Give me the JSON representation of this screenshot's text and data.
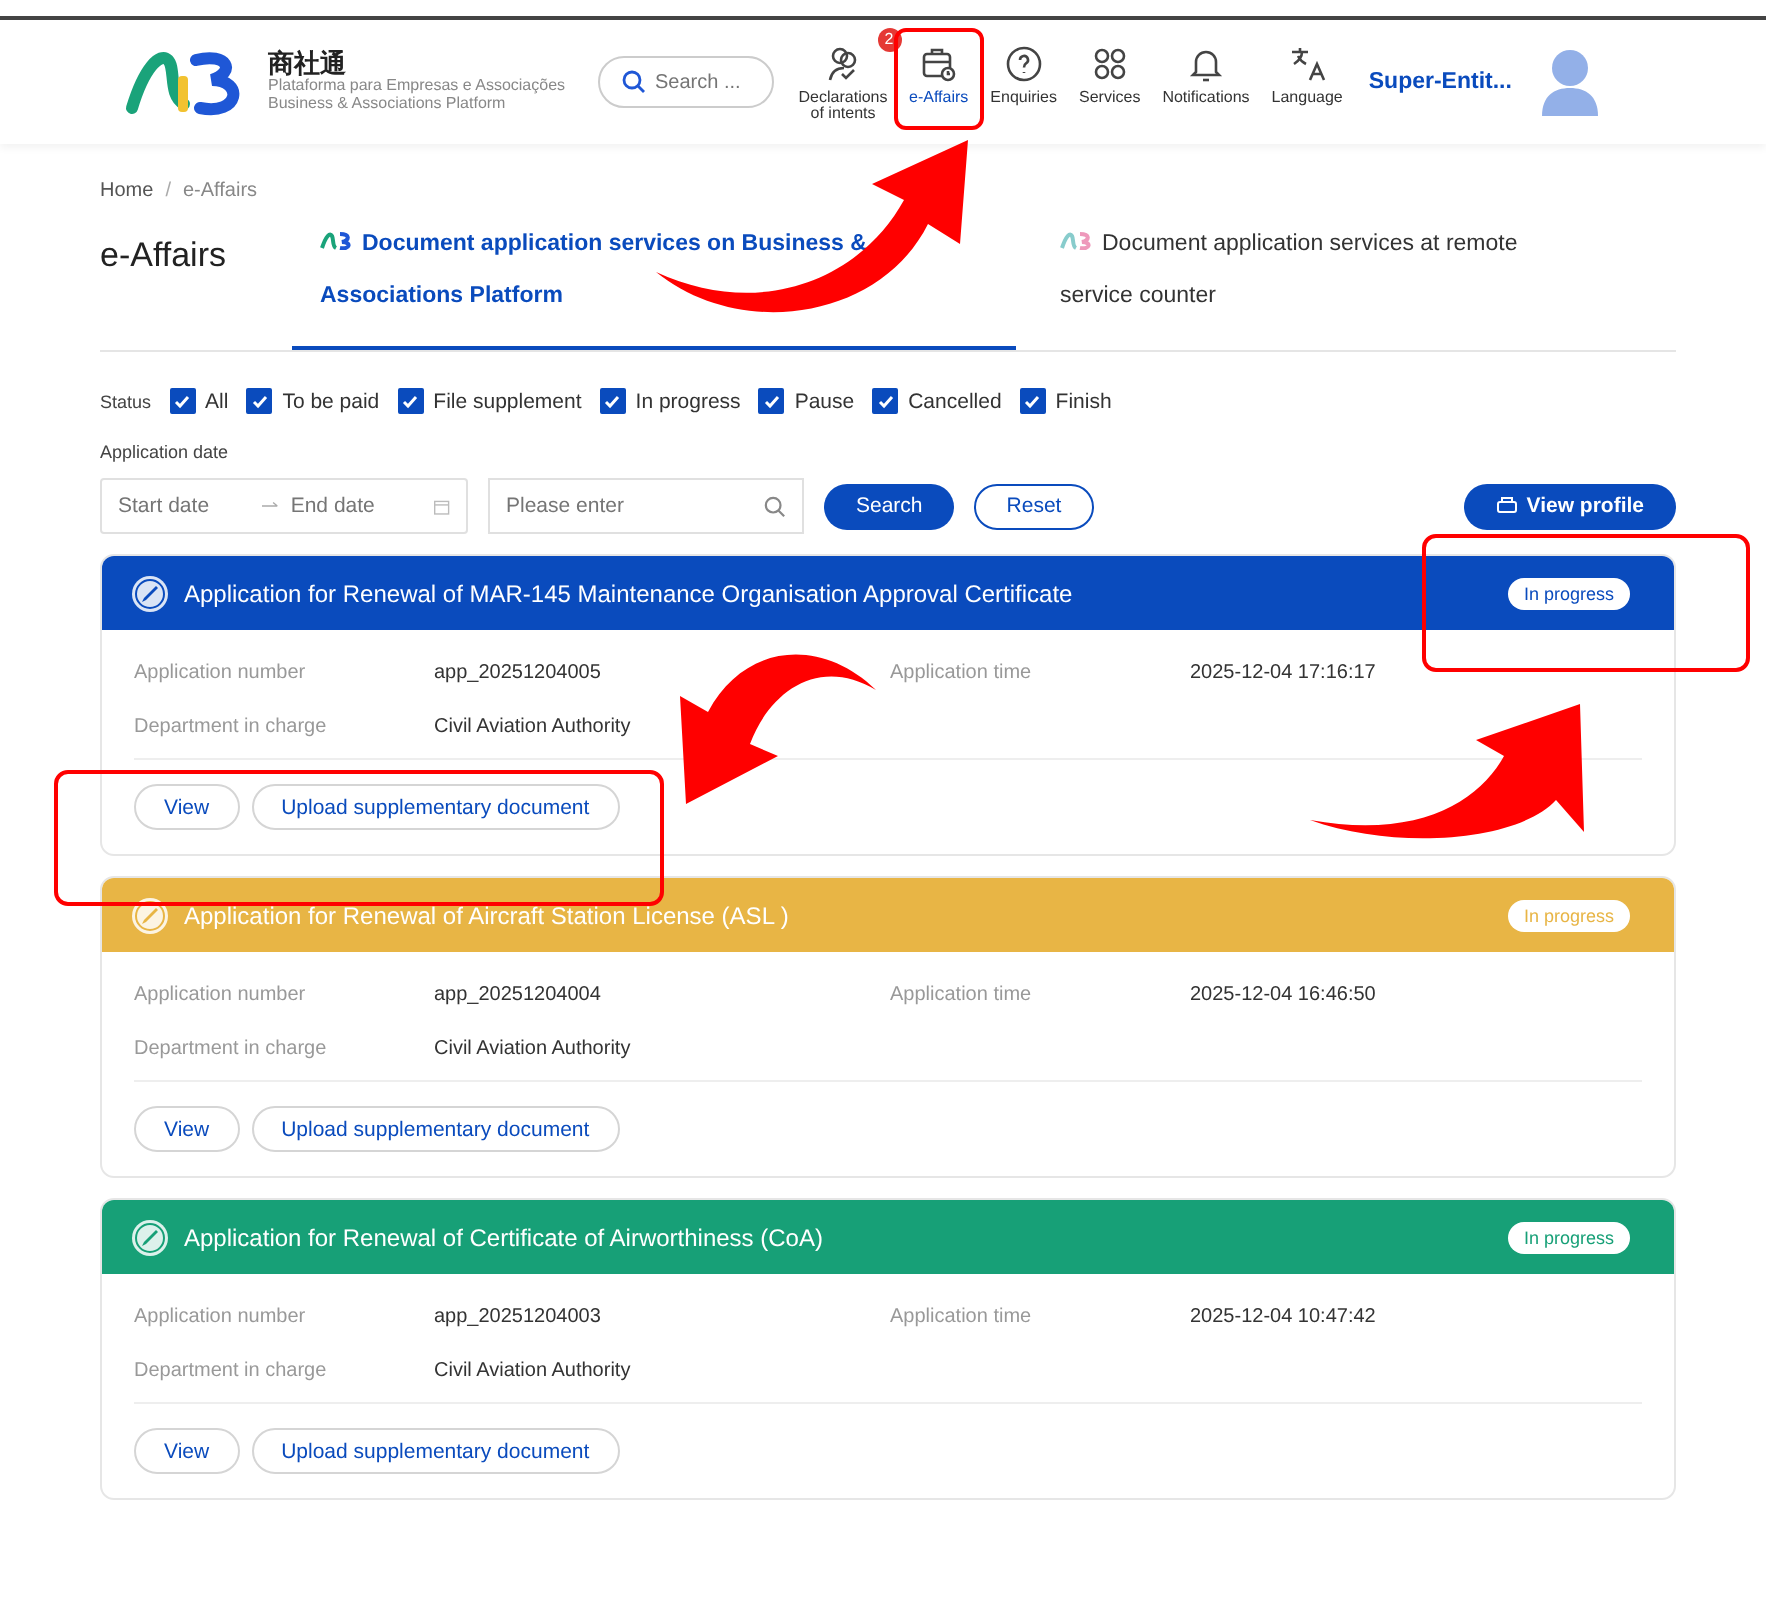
{
  "header": {
    "logo_title": "商社通",
    "logo_subtitle_1": "Plataforma para Empresas e Associações",
    "logo_subtitle_2": "Business & Associations Platform",
    "search": {
      "placeholder": "Search ..."
    },
    "nav": [
      {
        "kind": "declarations",
        "label": "Declarations of intents",
        "selected": false,
        "badge": "2"
      },
      {
        "kind": "affairs",
        "label": "e-Affairs",
        "selected": true
      },
      {
        "kind": "enquiries",
        "label": "Enquiries",
        "selected": false
      },
      {
        "kind": "services",
        "label": "Services",
        "selected": false
      },
      {
        "kind": "notifications",
        "label": "Notifications",
        "selected": false
      },
      {
        "kind": "language",
        "label": "Language",
        "selected": false
      }
    ],
    "user": "Super-Entit..."
  },
  "breadcrumb": [
    "Home",
    "e-Affairs"
  ],
  "breadcrumb_separator": "/",
  "page_title": "e-Affairs",
  "tabs": [
    {
      "kind": "platform",
      "label": "Document application services on Business & Associations Platform",
      "selected": true
    },
    {
      "kind": "remote",
      "label": "Document application services at remote service counter",
      "selected": false
    }
  ],
  "filters": {
    "status_label": "Status",
    "statuses": [
      {
        "label": "All",
        "checked": true
      },
      {
        "label": "To be paid",
        "checked": true
      },
      {
        "label": "File supplement",
        "checked": true
      },
      {
        "label": "In progress",
        "checked": true
      },
      {
        "label": "Pause",
        "checked": true
      },
      {
        "label": "Cancelled",
        "checked": true
      },
      {
        "label": "Finish",
        "checked": true
      }
    ],
    "date_label": "Application date",
    "start_placeholder": "Start date",
    "end_placeholder": "End date",
    "keyword_placeholder": "Please enter",
    "search_button": "Search",
    "reset_button": "Reset",
    "profile_button": "View profile"
  },
  "applications": [
    {
      "title": "Application for Renewal of MAR-145 Maintenance Organisation Approval Certificate",
      "color": "#0a4bbd",
      "status": "In progress",
      "number_label": "Application number",
      "number": "app_20251204005",
      "time_label": "Application time",
      "time": "2025-12-04 17:16:17",
      "dept_label": "Department in charge",
      "dept": "Civil Aviation Authority",
      "actions": [
        "View",
        "Upload supplementary document"
      ]
    },
    {
      "title": "Application for Renewal of Aircraft Station License (ASL )",
      "color": "#e8b545",
      "status": "In progress",
      "number_label": "Application number",
      "number": "app_20251204004",
      "time_label": "Application time",
      "time": "2025-12-04 16:46:50",
      "dept_label": "Department in charge",
      "dept": "Civil Aviation Authority",
      "actions": [
        "View",
        "Upload supplementary document"
      ]
    },
    {
      "title": "Application for Renewal of Certificate of Airworthiness (CoA)",
      "color": "#17a077",
      "status": "In progress",
      "number_label": "Application number",
      "number": "app_20251204003",
      "time_label": "Application time",
      "time": "2025-12-04 10:47:42",
      "dept_label": "Department in charge",
      "dept": "Civil Aviation Authority",
      "actions": [
        "View",
        "Upload supplementary document"
      ]
    }
  ]
}
